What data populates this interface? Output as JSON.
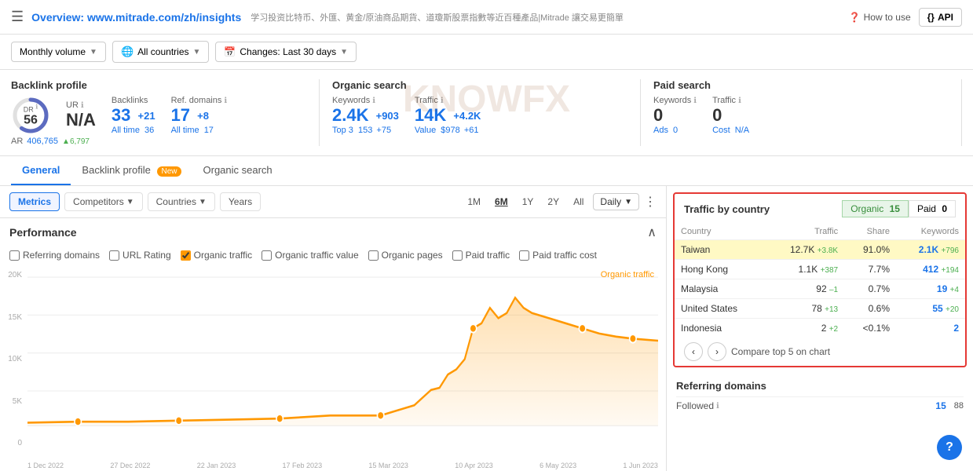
{
  "header": {
    "menu_icon": "☰",
    "title_prefix": "Overview: ",
    "title_url": "www.mitrade.com/zh/insights",
    "subtitle": "学习投资比特币、外匯、黄金/原油商品期貨、道瓊斯股票指數等近百種產品|Mitrade 讓交易更簡單",
    "how_to_use": "How to use",
    "api_label": "API"
  },
  "toolbar": {
    "monthly_volume": "Monthly volume",
    "all_countries": "All countries",
    "changes_label": "Changes: Last 30 days"
  },
  "stats": {
    "backlink_profile": {
      "title": "Backlink profile",
      "dr_label": "DR",
      "dr_value": "56",
      "ur_label": "UR",
      "ur_value": "N/A",
      "backlinks_label": "Backlinks",
      "backlinks_value": "33",
      "backlinks_delta": "+21",
      "backlinks_sub": "All time",
      "backlinks_sub_val": "36",
      "ref_domains_label": "Ref. domains",
      "ref_domains_value": "17",
      "ref_domains_delta": "+8",
      "ref_domains_sub": "All time",
      "ref_domains_sub_val": "17",
      "ar_label": "AR",
      "ar_value": "406,765",
      "ar_delta": "▲6,797"
    },
    "organic_search": {
      "title": "Organic search",
      "keywords_label": "Keywords",
      "keywords_value": "2.4K",
      "keywords_delta": "+903",
      "keywords_sub": "Top 3",
      "keywords_sub_val": "153",
      "keywords_sub_delta": "+75",
      "traffic_label": "Traffic",
      "traffic_value": "14K",
      "traffic_delta": "+4.2K",
      "traffic_sub": "Value",
      "traffic_sub_val": "$978",
      "traffic_sub_delta": "+61"
    },
    "paid_search": {
      "title": "Paid search",
      "keywords_label": "Keywords",
      "keywords_value": "0",
      "traffic_label": "Traffic",
      "traffic_value": "0",
      "cost_label": "Cost",
      "cost_value": "N/A",
      "ads_label": "Ads",
      "ads_value": "0"
    }
  },
  "tabs": {
    "general": "General",
    "backlink_profile": "Backlink profile",
    "new_badge": "New",
    "organic_search": "Organic search"
  },
  "chart_toolbar": {
    "metrics": "Metrics",
    "competitors": "Competitors",
    "countries": "Countries",
    "years": "Years",
    "period_1m": "1M",
    "period_6m": "6M",
    "period_1y": "1Y",
    "period_2y": "2Y",
    "period_all": "All",
    "interval": "Daily"
  },
  "performance": {
    "title": "Performance",
    "checkboxes": [
      {
        "id": "cb1",
        "label": "Referring domains",
        "checked": false,
        "color": "#ccc"
      },
      {
        "id": "cb2",
        "label": "URL Rating",
        "checked": false,
        "color": "#ccc"
      },
      {
        "id": "cb3",
        "label": "Organic traffic",
        "checked": true,
        "color": "#ff9800"
      },
      {
        "id": "cb4",
        "label": "Organic traffic value",
        "checked": false,
        "color": "#ccc"
      },
      {
        "id": "cb5",
        "label": "Organic pages",
        "checked": false,
        "color": "#ccc"
      },
      {
        "id": "cb6",
        "label": "Paid traffic",
        "checked": false,
        "color": "#ccc"
      },
      {
        "id": "cb7",
        "label": "Paid traffic cost",
        "checked": false,
        "color": "#ccc"
      }
    ],
    "line_label": "Organic traffic",
    "y_labels": [
      "20K",
      "15K",
      "10K",
      "5K",
      "0"
    ],
    "x_labels": [
      "1 Dec 2022",
      "27 Dec 2022",
      "22 Jan 2023",
      "17 Feb 2023",
      "15 Mar 2023",
      "10 Apr 2023",
      "6 May 2023",
      "1 Jun 2023"
    ]
  },
  "traffic_country": {
    "title": "Traffic by country",
    "organic_label": "Organic",
    "organic_count": "15",
    "paid_label": "Paid",
    "paid_count": "0",
    "columns": [
      "Country",
      "Traffic",
      "Share",
      "Keywords"
    ],
    "rows": [
      {
        "country": "Taiwan",
        "traffic": "12.7K",
        "delta": "+3.8K",
        "share": "91.0%",
        "keywords": "2.1K",
        "kw_delta": "+796",
        "highlight": true
      },
      {
        "country": "Hong Kong",
        "traffic": "1.1K",
        "delta": "+387",
        "share": "7.7%",
        "keywords": "412",
        "kw_delta": "+194",
        "highlight": false
      },
      {
        "country": "Malaysia",
        "traffic": "92",
        "delta": "–1",
        "share": "0.7%",
        "keywords": "19",
        "kw_delta": "+4",
        "highlight": false
      },
      {
        "country": "United States",
        "traffic": "78",
        "delta": "+13",
        "share": "0.6%",
        "keywords": "55",
        "kw_delta": "+20",
        "highlight": false
      },
      {
        "country": "Indonesia",
        "traffic": "2",
        "delta": "+2",
        "share": "<0.1%",
        "keywords": "2",
        "kw_delta": "",
        "highlight": false
      }
    ],
    "compare_label": "Compare top 5 on chart"
  },
  "referring_domains": {
    "title": "Referring domains",
    "followed_label": "Followed",
    "followed_val1": "15",
    "followed_val2": "88"
  }
}
